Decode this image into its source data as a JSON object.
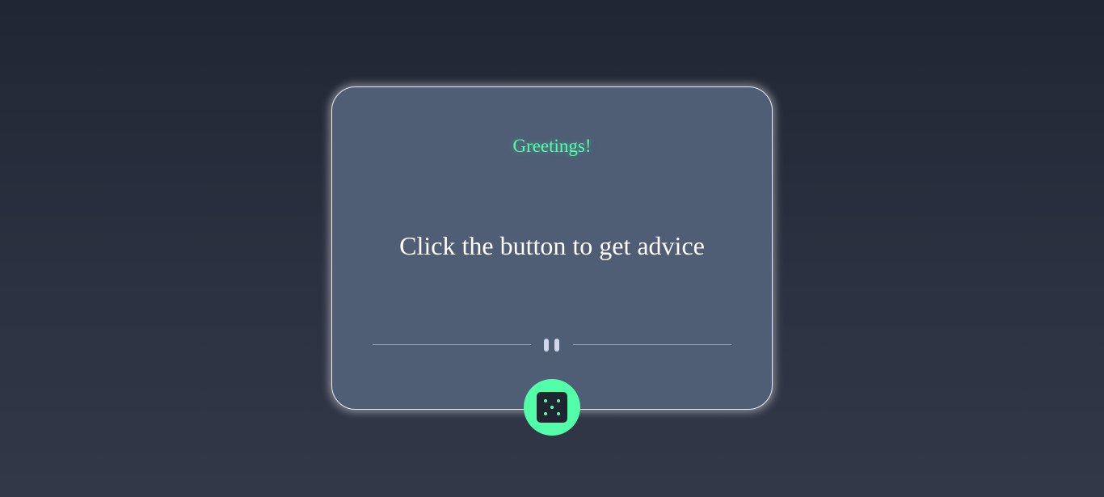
{
  "card": {
    "greeting": "Greetings!",
    "advice": "Click the button to get advice"
  },
  "divider": {
    "icon": "pause-icon"
  },
  "dice_button": {
    "icon": "dice-icon"
  },
  "colors": {
    "background_top": "#202633",
    "background_bottom": "#323848",
    "card": "#4f5d75",
    "accent": "#52ffa8",
    "text": "#ffffff",
    "dice_face": "#1f2632"
  }
}
